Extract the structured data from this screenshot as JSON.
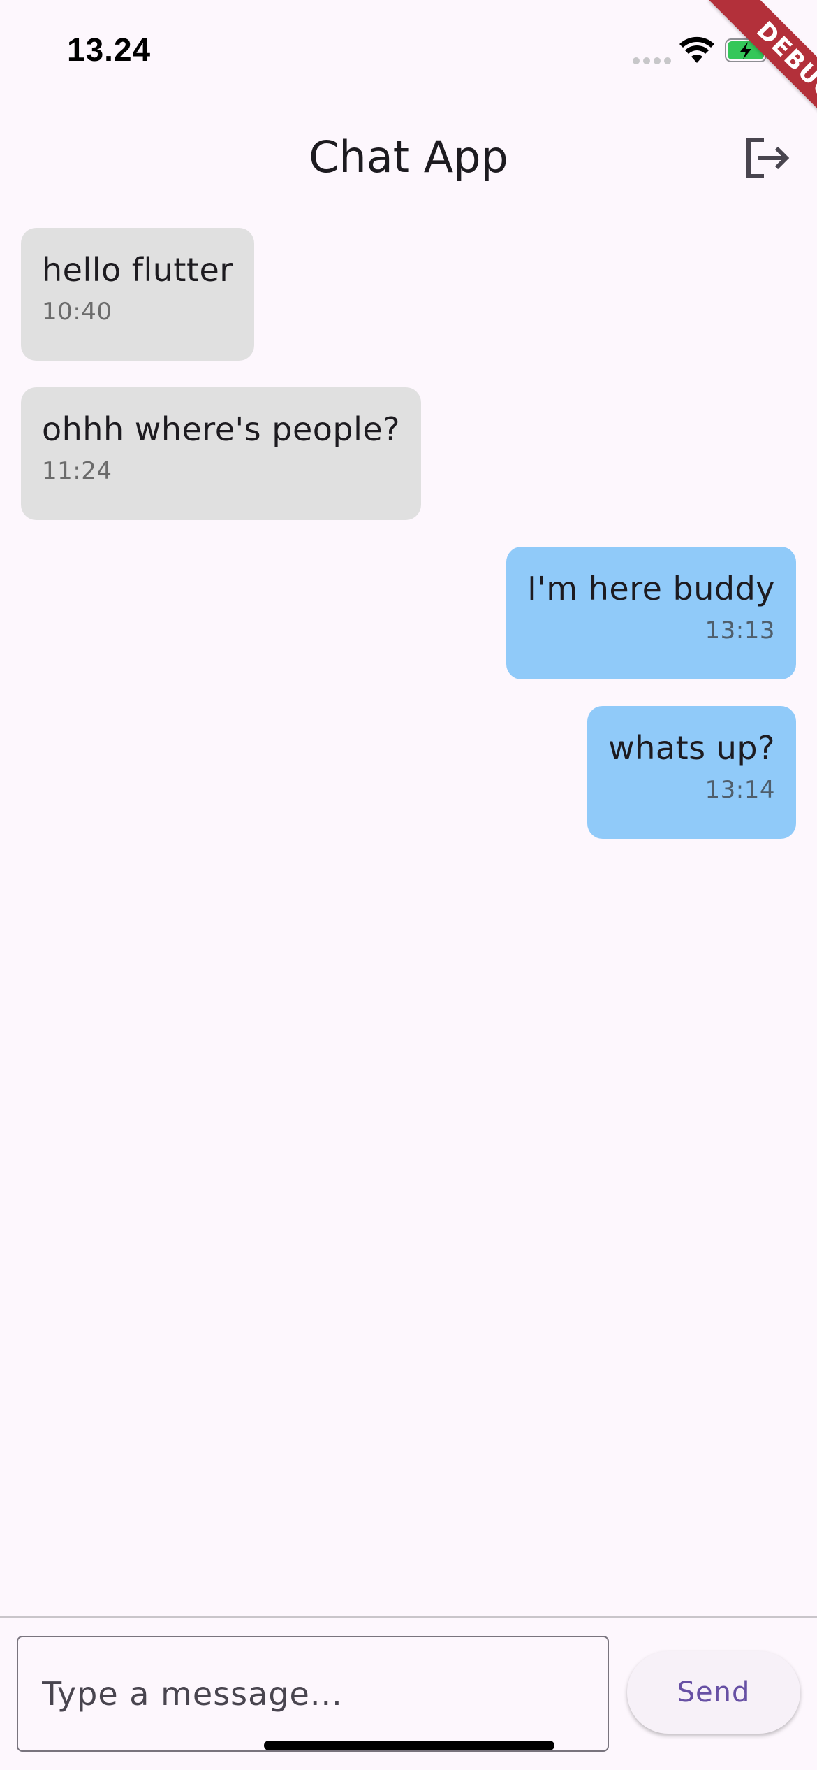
{
  "status_bar": {
    "time": "13.24",
    "icons": [
      "signal-icon",
      "wifi-icon",
      "battery-charging-icon"
    ],
    "battery_color": "#34c759"
  },
  "debug_banner": "DEBUG",
  "app_bar": {
    "title": "Chat App",
    "action_icon": "logout-icon"
  },
  "messages": [
    {
      "text": "hello flutter",
      "time": "10:40",
      "direction": "received"
    },
    {
      "text": "ohhh where's people?",
      "time": "11:24",
      "direction": "received"
    },
    {
      "text": "I'm here buddy",
      "time": "13:13",
      "direction": "sent"
    },
    {
      "text": "whats up?",
      "time": "13:14",
      "direction": "sent"
    }
  ],
  "composer": {
    "placeholder": "Type a message...",
    "value": "",
    "send_label": "Send"
  },
  "colors": {
    "background": "#fdf7fd",
    "received_bubble": "#e0e0e0",
    "sent_bubble": "#90caf9",
    "accent": "#6750a4",
    "debug_banner": "#b3303a"
  }
}
